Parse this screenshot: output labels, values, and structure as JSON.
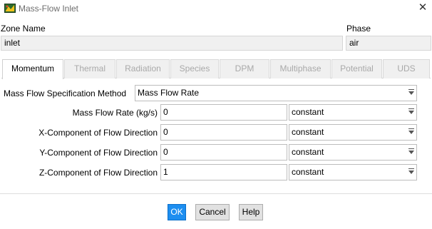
{
  "window": {
    "title": "Mass-Flow Inlet",
    "close_icon": "close-icon"
  },
  "zone": {
    "label": "Zone Name",
    "value": "inlet"
  },
  "phase": {
    "label": "Phase",
    "value": "air"
  },
  "tabs": [
    {
      "label": "Momentum",
      "active": true
    },
    {
      "label": "Thermal",
      "active": false
    },
    {
      "label": "Radiation",
      "active": false
    },
    {
      "label": "Species",
      "active": false
    },
    {
      "label": "DPM",
      "active": false
    },
    {
      "label": "Multiphase",
      "active": false
    },
    {
      "label": "Potential",
      "active": false
    },
    {
      "label": "UDS",
      "active": false
    }
  ],
  "momentum": {
    "spec_method": {
      "label": "Mass Flow Specification Method",
      "value": "Mass Flow Rate"
    },
    "rows": [
      {
        "label": "Mass Flow Rate (kg/s)",
        "value": "0",
        "method": "constant"
      },
      {
        "label": "X-Component of Flow Direction",
        "value": "0",
        "method": "constant"
      },
      {
        "label": "Y-Component of Flow Direction",
        "value": "0",
        "method": "constant"
      },
      {
        "label": "Z-Component of Flow Direction",
        "value": "1",
        "method": "constant"
      }
    ]
  },
  "buttons": {
    "ok": "OK",
    "cancel": "Cancel",
    "help": "Help"
  },
  "colors": {
    "accent": "#1d8ef0",
    "disabled_tab_text": "#a9a9a9"
  }
}
